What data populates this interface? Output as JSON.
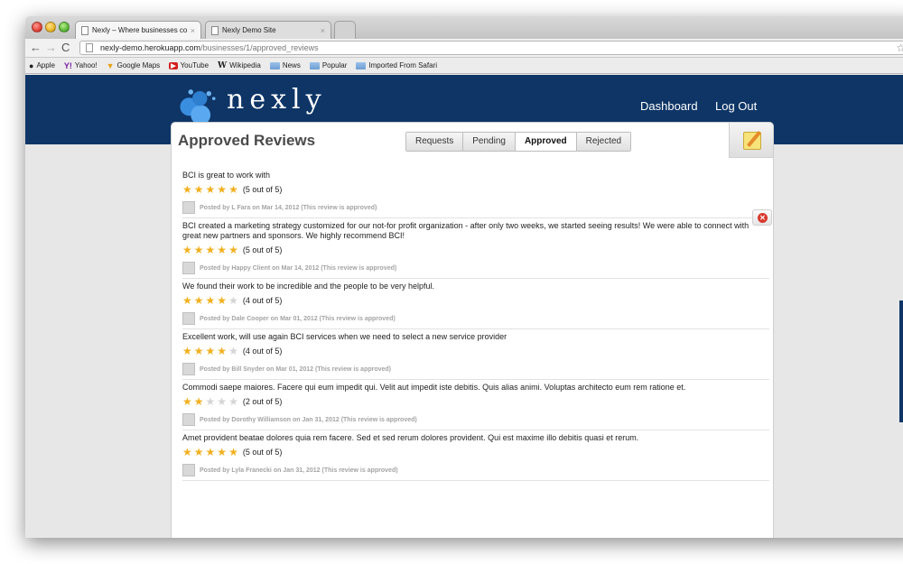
{
  "browser": {
    "tabs": [
      {
        "label": "Nexly – Where businesses co",
        "close": "×"
      },
      {
        "label": "Nexly Demo Site",
        "close": "×"
      }
    ],
    "url_host": "nexly-demo.herokuapp.com",
    "url_path": "/businesses/1/approved_reviews",
    "bookmarks": [
      {
        "label": "Apple",
        "icon": ""
      },
      {
        "label": "Yahoo!",
        "icon": "Y!"
      },
      {
        "label": "Google Maps",
        "icon": "maps"
      },
      {
        "label": "YouTube",
        "icon": "▶"
      },
      {
        "label": "Wikipedia",
        "icon": "W"
      },
      {
        "label": "News",
        "icon": "folder"
      },
      {
        "label": "Popular",
        "icon": "folder"
      },
      {
        "label": "Imported From Safari",
        "icon": "folder"
      }
    ]
  },
  "site": {
    "logo_text": "nexly",
    "nav": {
      "dashboard": "Dashboard",
      "logout": "Log Out"
    }
  },
  "panel": {
    "title": "Approved Reviews",
    "tabs": [
      "Requests",
      "Pending",
      "Approved",
      "Rejected"
    ],
    "active_tab": "Approved"
  },
  "reviews": [
    {
      "text": "BCI is great to work with",
      "rating": 5,
      "rating_text": "(5 out of 5)",
      "meta": "Posted by L Fara on Mar 14, 2012 (This review is approved)"
    },
    {
      "text": "BCI created a marketing strategy customized for our not-for profit organization - after only two weeks, we started seeing results! We were able to connect with great new partners and sponsors. We highly recommend BCI!",
      "rating": 5,
      "rating_text": "(5 out of 5)",
      "meta": "Posted by Happy Client on Mar 14, 2012 (This review is approved)"
    },
    {
      "text": "We found their work to be incredible and the people to be very helpful.",
      "rating": 4,
      "rating_text": "(4 out of 5)",
      "meta": "Posted by Dale Cooper on Mar 01, 2012 (This review is approved)"
    },
    {
      "text": "Excellent work, will use again BCI services when we need to select a new service provider",
      "rating": 4,
      "rating_text": "(4 out of 5)",
      "meta": "Posted by Bill Snyder on Mar 01, 2012 (This review is approved)"
    },
    {
      "text": "Commodi saepe maiores. Facere qui eum impedit qui. Velit aut impedit iste debitis. Quis alias animi. Voluptas architecto eum rem ratione et.",
      "rating": 2,
      "rating_text": "(2 out of 5)",
      "meta": "Posted by Dorothy Williamson on Jan 31, 2012 (This review is approved)"
    },
    {
      "text": "Amet provident beatae dolores quia rem facere. Sed et sed rerum dolores provident. Qui est maxime illo debitis quasi et rerum.",
      "rating": 5,
      "rating_text": "(5 out of 5)",
      "meta": "Posted by Lyla Franecki on Jan 31, 2012 (This review is approved)"
    }
  ],
  "colors": {
    "brand_navy": "#0e3566",
    "star_on": "#f2b01e",
    "star_off": "#d4d4d4",
    "delete_red": "#d8392e"
  }
}
